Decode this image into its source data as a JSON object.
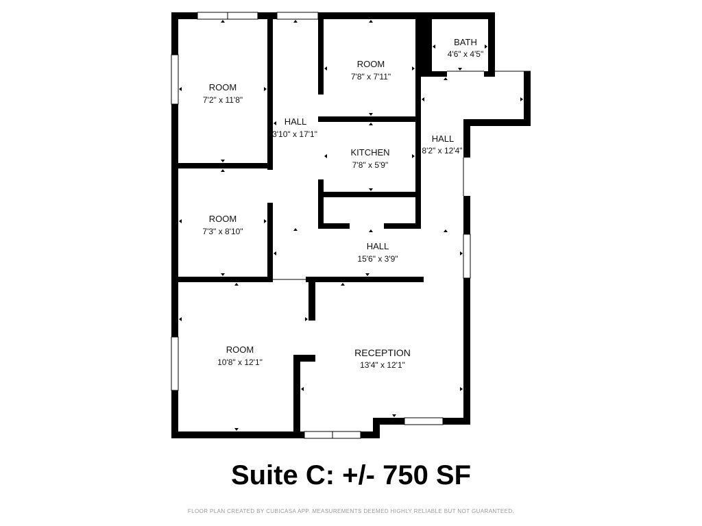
{
  "floor_plan": {
    "rooms": [
      {
        "id": "room-1",
        "name": "ROOM",
        "dims": "7'2\" x 11'8\""
      },
      {
        "id": "room-2",
        "name": "ROOM",
        "dims": "7'3\" x 8'10\""
      },
      {
        "id": "room-3",
        "name": "ROOM",
        "dims": "10'8\" x 12'1\""
      },
      {
        "id": "room-4",
        "name": "ROOM",
        "dims": "7'8\" x 7'11\""
      },
      {
        "id": "kitchen",
        "name": "KITCHEN",
        "dims": "7'8\" x 5'9\""
      },
      {
        "id": "bath",
        "name": "BATH",
        "dims": "4'6\" x 4'5\""
      },
      {
        "id": "hall-1",
        "name": "HALL",
        "dims": "3'10\" x 17'1\""
      },
      {
        "id": "hall-2",
        "name": "HALL",
        "dims": "8'2\" x 12'4\""
      },
      {
        "id": "hall-3",
        "name": "HALL",
        "dims": "15'6\" x 3'9\""
      },
      {
        "id": "reception",
        "name": "RECEPTION",
        "dims": "13'4\" x 12'1\""
      }
    ]
  },
  "title": "Suite C: +/- 750 SF",
  "credit": "FLOOR PLAN CREATED BY CUBICASA APP. MEASUREMENTS DEEMED HIGHLY RELIABLE BUT NOT GUARANTEED."
}
